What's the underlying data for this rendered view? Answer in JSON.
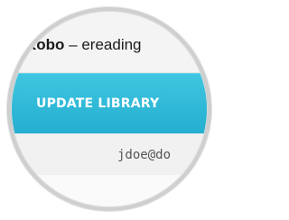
{
  "window": {
    "brand": "Kobo",
    "title_suffix": " – ereading"
  },
  "main": {
    "update_button_label": "UPDATE LIBRARY"
  },
  "account": {
    "email": "jdoe@do"
  },
  "colors": {
    "button_accent": "#2bb6d6"
  }
}
